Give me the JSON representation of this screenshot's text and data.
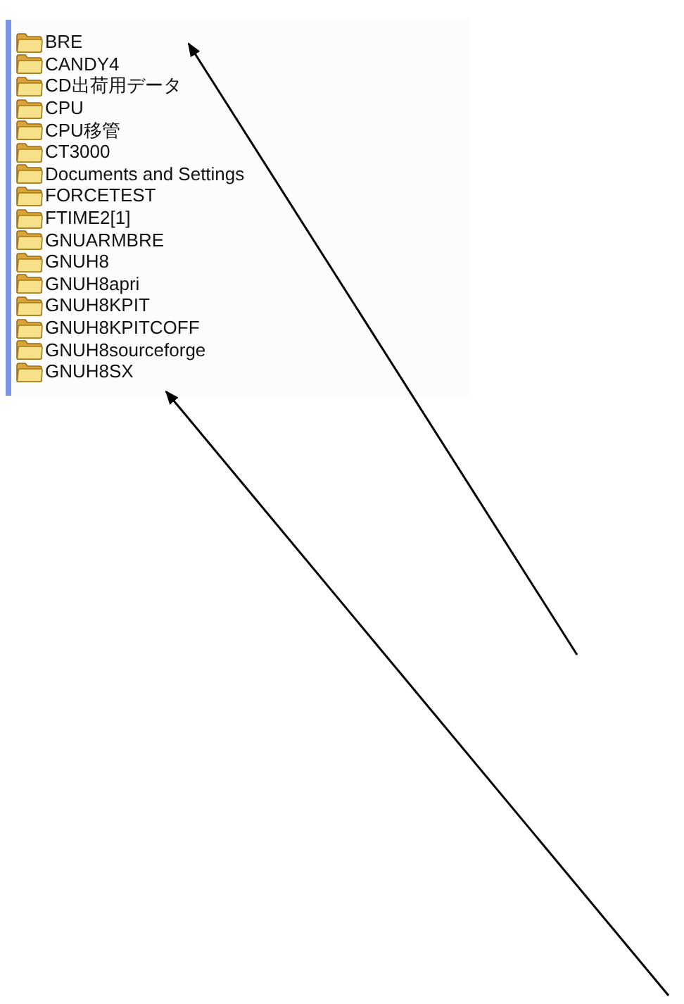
{
  "folders": [
    {
      "name": "BRE"
    },
    {
      "name": "CANDY4"
    },
    {
      "name": "CD出荷用データ"
    },
    {
      "name": "CPU"
    },
    {
      "name": "CPU移管"
    },
    {
      "name": "CT3000"
    },
    {
      "name": "Documents and Settings"
    },
    {
      "name": "FORCETEST"
    },
    {
      "name": "FTIME2[1]"
    },
    {
      "name": "GNUARMBRE"
    },
    {
      "name": "GNUH8"
    },
    {
      "name": "GNUH8apri"
    },
    {
      "name": "GNUH8KPIT"
    },
    {
      "name": "GNUH8KPITCOFF"
    },
    {
      "name": "GNUH8sourceforge"
    },
    {
      "name": "GNUH8SX"
    }
  ]
}
